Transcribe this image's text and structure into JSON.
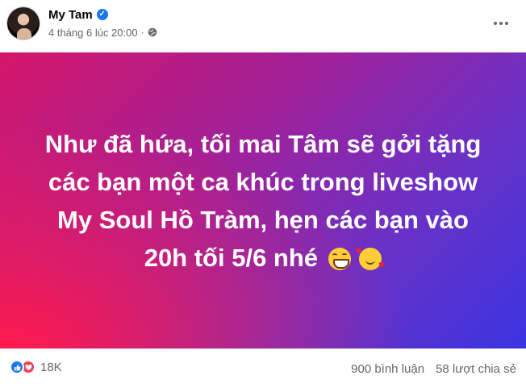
{
  "header": {
    "author_name": "My Tam",
    "timestamp": "4 tháng 6 lúc 20:00",
    "separator": "·",
    "audience_icon": "globe-icon",
    "verified_icon": "verified-badge-icon",
    "menu_icon": "more-options-icon"
  },
  "post": {
    "lines": [
      "Như đã hứa, tối mai Tâm sẽ gởi tặng",
      "các bạn một ca khúc trong liveshow",
      "My Soul Hồ Tràm, hẹn các bạn vào",
      "20h tối 5/6 nhé"
    ],
    "emojis": [
      "grinning-face-emoji",
      "smiling-face-with-hearts-emoji"
    ],
    "background_colors": [
      "#ff1a4d",
      "#d51669",
      "#a1219a",
      "#6a31c6",
      "#3b34e1"
    ]
  },
  "stats": {
    "reaction_icons": [
      "like-icon",
      "heart-icon"
    ],
    "reaction_count": "18K",
    "comments": "900 bình luận",
    "shares": "58 lượt chia sẻ"
  },
  "colors": {
    "accent": "#1877f2",
    "secondary_text": "#65676b",
    "love": "#f33e58"
  }
}
